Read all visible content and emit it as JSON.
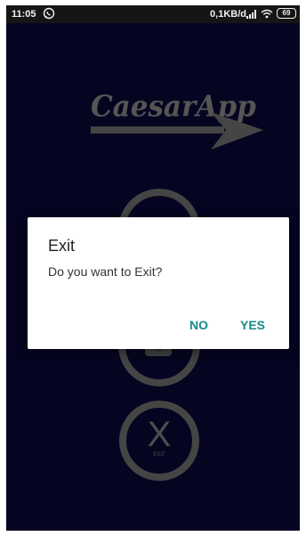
{
  "status_bar": {
    "time": "11:05",
    "notification_icon": "whatsapp-icon",
    "network_speed": "0,1KB/d",
    "battery_level": "69"
  },
  "background": {
    "logo_text": "CaesarApp",
    "exit_circle_letter": "X",
    "exit_circle_label": "EXIT"
  },
  "dialog": {
    "title": "Exit",
    "message": "Do you want to Exit?",
    "no_label": "NO",
    "yes_label": "YES"
  },
  "colors": {
    "background": "#0c0a3c",
    "accent": "#168a85",
    "status_bar": "#151515"
  }
}
